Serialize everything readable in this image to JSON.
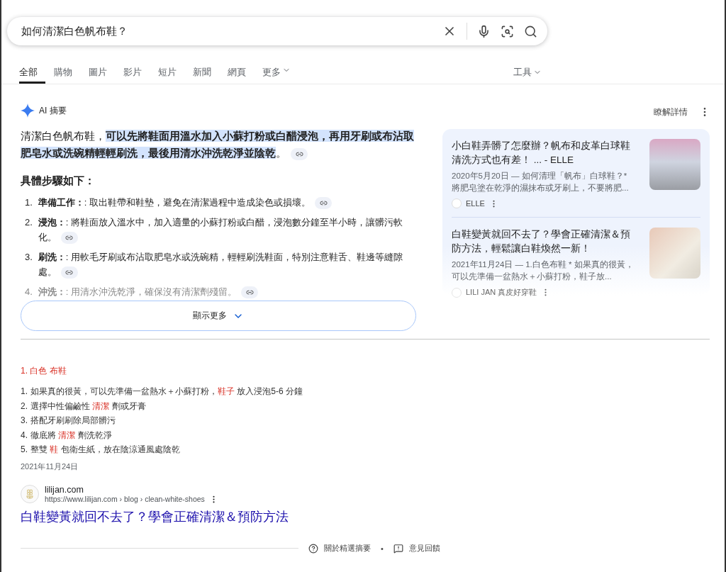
{
  "search": {
    "value": "如何清潔白色帆布鞋？"
  },
  "tabs": [
    {
      "label": "全部",
      "selected": true
    },
    {
      "label": "購物",
      "selected": false
    },
    {
      "label": "圖片",
      "selected": false
    },
    {
      "label": "影片",
      "selected": false
    },
    {
      "label": "短片",
      "selected": false
    },
    {
      "label": "新聞",
      "selected": false
    },
    {
      "label": "網頁",
      "selected": false
    },
    {
      "label": "更多",
      "selected": false,
      "dropdown": true
    }
  ],
  "tools": {
    "label": "工具"
  },
  "ai_overview": {
    "title": "AI 摘要",
    "learn_more": "瞭解詳情",
    "summary": [
      {
        "text": "清潔白色帆布鞋，",
        "highlighted": false
      },
      {
        "text": "可以先將鞋面用溫水加入小蘇打粉或白醋浸泡，再用牙刷或布沾取肥皂水或洗碗精輕輕刷洗，最後用清水沖洗乾淨並陰乾",
        "highlighted": true
      },
      {
        "text": "。",
        "highlighted": false
      }
    ],
    "steps_heading": "具體步驟如下：",
    "steps": [
      {
        "number": "1.",
        "title": "準備工作：",
        "text": ": 取出鞋帶和鞋墊，避免在清潔過程中造成染色或損壞。",
        "faded": false
      },
      {
        "number": "2.",
        "title": "浸泡：",
        "text": ": 將鞋面放入溫水中，加入適量的小蘇打粉或白醋，浸泡數分鐘至半小時，讓髒污軟化。",
        "faded": false
      },
      {
        "number": "3.",
        "title": "刷洗：",
        "text": ": 用軟毛牙刷或布沾取肥皂水或洗碗精，輕輕刷洗鞋面，特別注意鞋舌、鞋邊等縫隙處。",
        "faded": false
      },
      {
        "number": "4.",
        "title": "沖洗：",
        "text": ": 用清水沖洗乾淨，確保沒有清潔劑殘留。",
        "faded": true
      }
    ],
    "show_more": "顯示更多",
    "sources": [
      {
        "title": "小白鞋弄髒了怎麼辦？帆布和皮革白球鞋清洗方式也有差！ ... - ELLE",
        "snippet": "2020年5月20日 — 如何清理「帆布」白球鞋？* 將肥皂塗在乾淨的濕抹布或牙刷上，不要將肥...",
        "site": "ELLE",
        "faded": false
      },
      {
        "title": "白鞋變黃就回不去了？學會正確清潔＆預防方法，輕鬆讓白鞋煥然一新！",
        "snippet": "2021年11月24日 — 1.白色布鞋 * 如果真的很黃，可以先準備一盆熱水＋小蘇打粉，鞋子放...",
        "site": "LILI JAN 真皮好穿鞋",
        "faded": true
      }
    ]
  },
  "snippet": {
    "heading": "1. 白色 布鞋",
    "items": [
      {
        "number": "1.",
        "parts": [
          {
            "text": "如果真的很黃，可以先準備一盆熱水＋小蘇打粉，",
            "emphasis": false
          },
          {
            "text": "鞋子",
            "emphasis": true
          },
          {
            "text": " 放入浸泡5-6 分鐘",
            "emphasis": false
          }
        ]
      },
      {
        "number": "2.",
        "parts": [
          {
            "text": "選擇中性偏鹼性 ",
            "emphasis": false
          },
          {
            "text": "清潔",
            "emphasis": true
          },
          {
            "text": " 劑或牙膏",
            "emphasis": false
          }
        ]
      },
      {
        "number": "3.",
        "parts": [
          {
            "text": "搭配牙刷刷除局部髒污",
            "emphasis": false
          }
        ]
      },
      {
        "number": "4.",
        "parts": [
          {
            "text": "徹底將 ",
            "emphasis": false
          },
          {
            "text": "清潔",
            "emphasis": true
          },
          {
            "text": " 劑洗乾淨",
            "emphasis": false
          }
        ]
      },
      {
        "number": "5.",
        "parts": [
          {
            "text": "整雙 ",
            "emphasis": false
          },
          {
            "text": "鞋",
            "emphasis": true
          },
          {
            "text": " 包衛生紙，放在陰涼通風處陰乾",
            "emphasis": false
          }
        ]
      }
    ],
    "date": "2021年11月24日",
    "site_name": "lilijan.com",
    "url": "https://www.lilijan.com › blog › clean-white-shoes",
    "title": "白鞋變黃就回不去了？學會正確清潔＆預防方法"
  },
  "footer": {
    "about": "關於精選摘要",
    "separator": "•",
    "feedback": "意見回饋"
  }
}
